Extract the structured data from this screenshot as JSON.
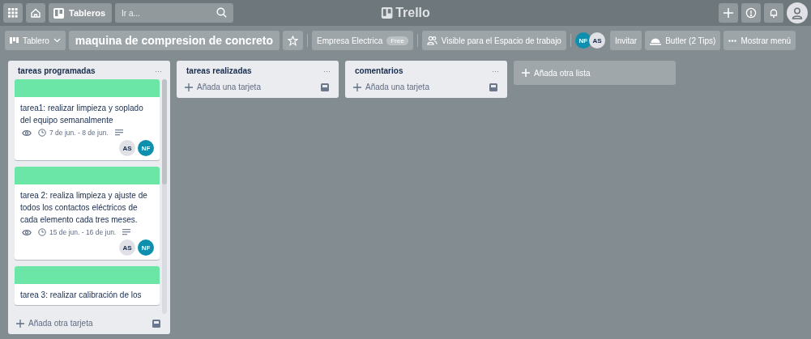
{
  "top_bar": {
    "boards_label": "Tableros",
    "search": {
      "placeholder": "Ir a..."
    },
    "logo": "Trello"
  },
  "board_header": {
    "view": "Tablero",
    "title": "maquina de compresion de concreto",
    "starred": false,
    "workspace": "Empresa Electrica",
    "plan_badge": "Free",
    "visibility": "Visible para el Espacio de trabajo",
    "members": [
      {
        "initials": "NF",
        "color": "#0e8fae"
      },
      {
        "initials": "AS",
        "color": "#dfe1e6"
      }
    ],
    "invite": "Invitar",
    "butler": "Butler (2 Tips)",
    "menu": "Mostrar menú"
  },
  "lists": [
    {
      "name": "tareas programadas",
      "menu": "···",
      "cards": [
        {
          "color": "#6ce6a6",
          "title": "tarea1: realizar limpieza y soplado del equipo semanalmente",
          "watching": true,
          "dates": "7 de jun. - 8 de jun.",
          "description": true,
          "members": [
            {
              "initials": "AS",
              "color": "#dfe1e6"
            },
            {
              "initials": "NF",
              "color": "#0e8fae"
            }
          ]
        },
        {
          "color": "#6ce6a6",
          "title": "tarea 2: realiza limpieza y ajuste de todos los contactos eléctricos de cada elemento cada tres meses.",
          "watching": true,
          "dates": "15 de jun. - 16 de jun.",
          "description": true,
          "members": [
            {
              "initials": "AS",
              "color": "#dfe1e6"
            },
            {
              "initials": "NF",
              "color": "#0e8fae"
            }
          ]
        },
        {
          "color": "#6ce6a6",
          "title": "tarea 3: realizar calibración de los"
        }
      ],
      "add_card": "Añada otra tarjeta"
    },
    {
      "name": "tareas realizadas",
      "menu": "···",
      "add_card": "Añada una tarjeta"
    },
    {
      "name": "comentarios",
      "menu": "···",
      "add_card": "Añada una tarjeta"
    }
  ],
  "add_list": "Añada otra lista"
}
